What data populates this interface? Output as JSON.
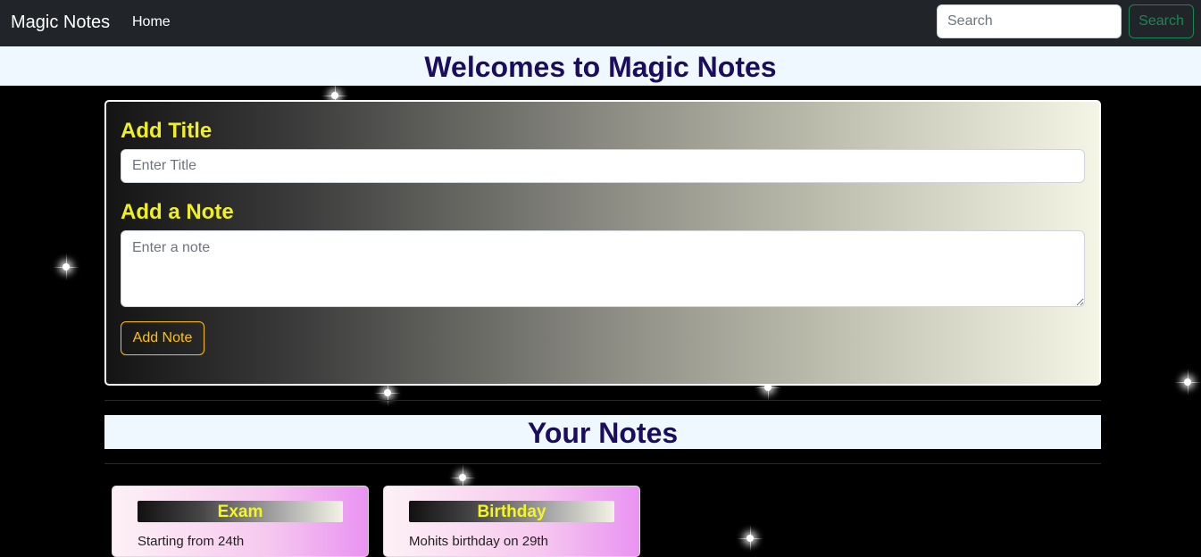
{
  "navbar": {
    "brand": "Magic Notes",
    "home_label": "Home",
    "search_placeholder": "Search",
    "search_button": "Search"
  },
  "welcome": {
    "title": "Welcomes to Magic Notes"
  },
  "add_note": {
    "title_label": "Add Title",
    "title_placeholder": "Enter Title",
    "note_label": "Add a Note",
    "note_placeholder": "Enter a note",
    "add_button": "Add Note"
  },
  "notes_section": {
    "heading": "Your Notes"
  },
  "notes": [
    {
      "title": "Exam",
      "text": "Starting from 24th"
    },
    {
      "title": "Birthday",
      "text": "Mohits birthday on 29th"
    }
  ],
  "colors": {
    "navbar_bg": "#212529",
    "banner_bg": "#f0f8ff",
    "heading_text": "#1a0c5e",
    "label_yellow": "#f0f020",
    "search_green": "#198754",
    "add_button_amber": "#ffc107"
  }
}
